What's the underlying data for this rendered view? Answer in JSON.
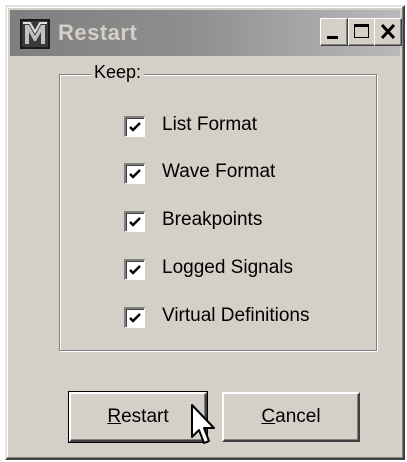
{
  "window": {
    "title": "Restart",
    "app_icon": "modelsim-icon",
    "controls": {
      "minimize": "minimize-icon",
      "maximize": "maximize-icon",
      "close": "close-icon"
    }
  },
  "group": {
    "label": "Keep:",
    "options": [
      {
        "label": "List Format",
        "checked": true
      },
      {
        "label": "Wave Format",
        "checked": true
      },
      {
        "label": "Breakpoints",
        "checked": true
      },
      {
        "label": "Logged Signals",
        "checked": true
      },
      {
        "label": "Virtual Definitions",
        "checked": true
      }
    ]
  },
  "buttons": {
    "restart": {
      "mnemonic": "R",
      "rest": "estart"
    },
    "cancel": {
      "mnemonic": "C",
      "rest": "ancel"
    }
  },
  "colors": {
    "face": "#d4d0c8",
    "titlebar_inactive_start": "#7f7f7f",
    "titlebar_inactive_end": "#b9b9b9"
  }
}
